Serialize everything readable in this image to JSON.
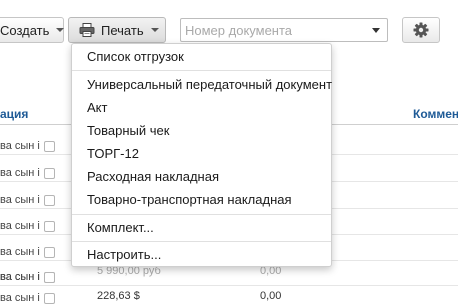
{
  "toolbar": {
    "create_label": "Создать",
    "print_label": "Печать",
    "search_placeholder": "Номер документа"
  },
  "table": {
    "headers": {
      "col_left": "ация",
      "col_right": "Коммент"
    },
    "rows": [
      {
        "name": "ва сын і",
        "amount": "",
        "zero": ""
      },
      {
        "name": "ва сын і",
        "amount": "",
        "zero": ""
      },
      {
        "name": "ва сын і",
        "amount": "",
        "zero": ""
      },
      {
        "name": "ва сын і",
        "amount": "",
        "zero": ""
      },
      {
        "name": "ва сын і",
        "amount": "",
        "zero": ""
      },
      {
        "name": "ва сын і",
        "amount": "",
        "zero": ""
      },
      {
        "name": "ва сын і",
        "amount": "5 990,00 руб",
        "zero": "0,00"
      },
      {
        "name": "ва сын і",
        "amount": "228,63 $",
        "zero": "0,00"
      }
    ]
  },
  "print_menu": {
    "items": [
      "Список отгрузок",
      "Универсальный передаточный документ",
      "Акт",
      "Товарный чек",
      "ТОРГ-12",
      "Расходная накладная",
      "Товарно-транспортная накладная",
      "Комплект...",
      "Настроить..."
    ]
  },
  "icons": {
    "print": "printer-icon",
    "settings": "gear-icon"
  }
}
